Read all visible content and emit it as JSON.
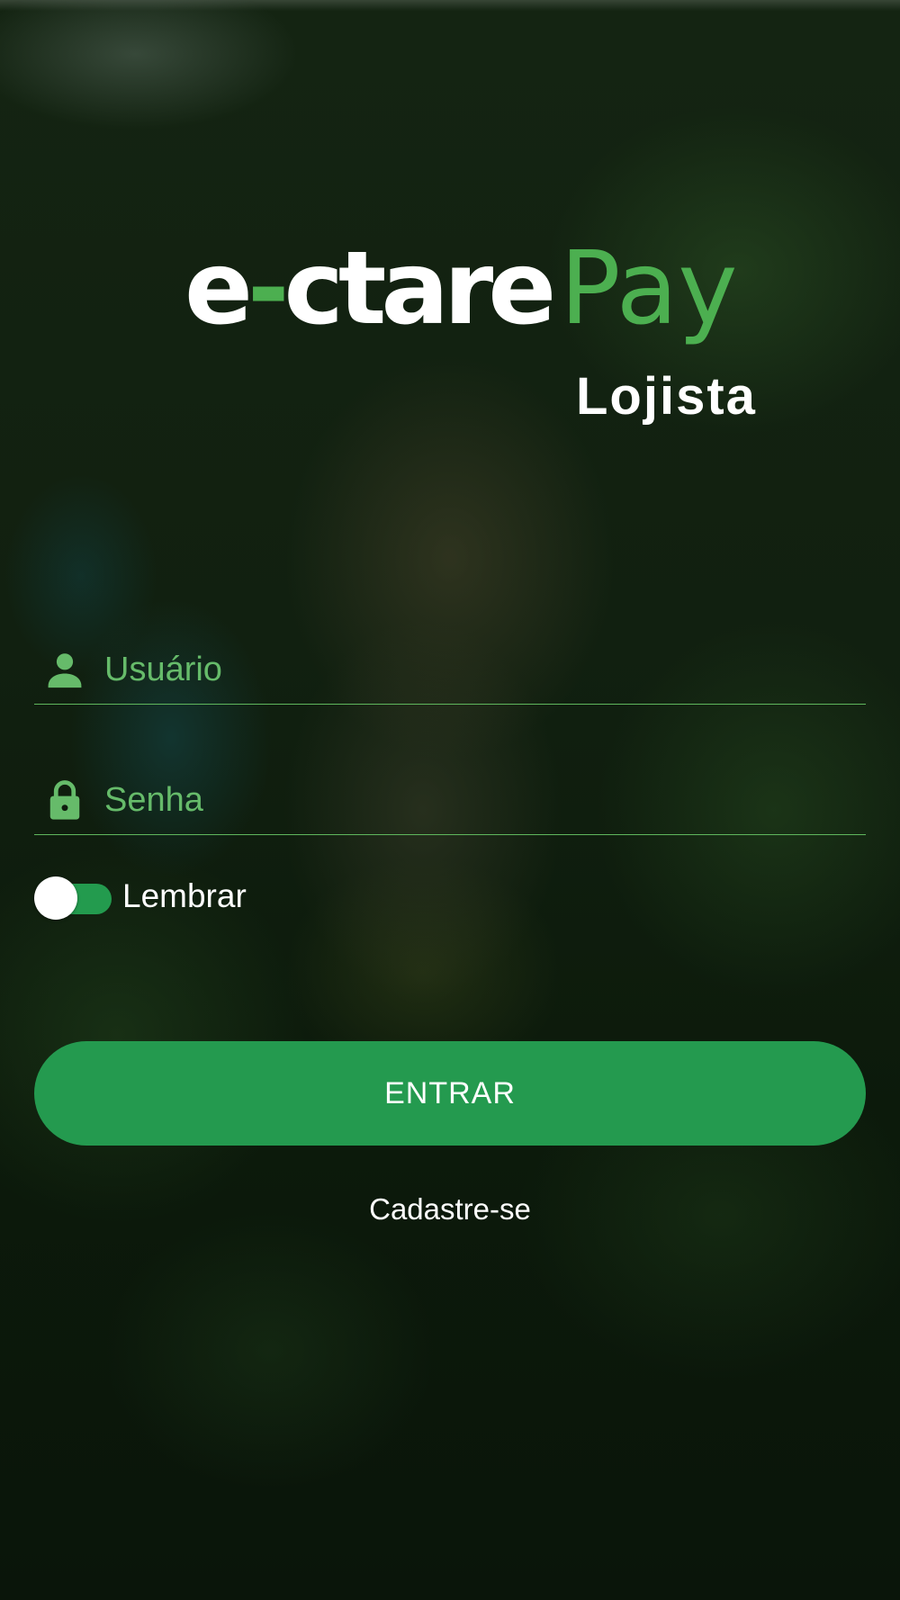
{
  "brand": {
    "logo_e": "e",
    "logo_ctare": "ctare",
    "logo_pay": "Pay",
    "subtitle": "Lojista",
    "colors": {
      "primary_green": "#249a4f",
      "accent_green": "#4caf50",
      "placeholder_green": "#66bb6a",
      "text_white": "#ffffff"
    }
  },
  "form": {
    "username": {
      "icon": "person-icon",
      "placeholder": "Usuário",
      "value": ""
    },
    "password": {
      "icon": "lock-icon",
      "placeholder": "Senha",
      "value": ""
    },
    "remember": {
      "label": "Lembrar",
      "on": true
    },
    "submit_label": "ENTRAR",
    "register_link": "Cadastre-se"
  }
}
